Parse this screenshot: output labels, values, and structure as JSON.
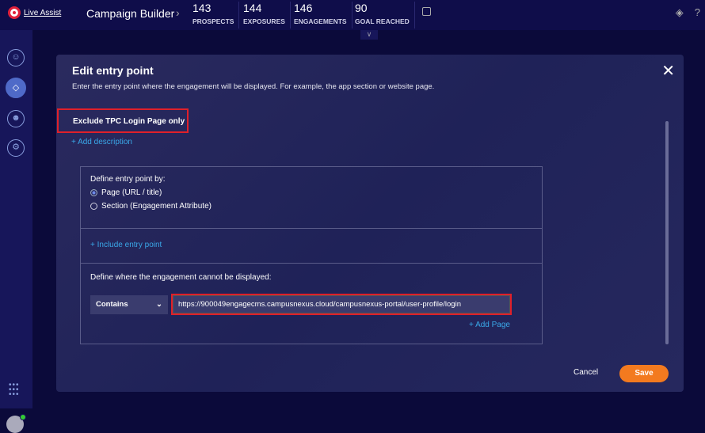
{
  "header": {
    "logo_text": "Live Assist",
    "title": "Campaign Builder",
    "stats": [
      {
        "value": "143",
        "label": "PROSPECTS"
      },
      {
        "value": "144",
        "label": "EXPOSURES"
      },
      {
        "value": "146",
        "label": "ENGAGEMENTS"
      },
      {
        "value": "90",
        "label": "GOAL REACHED"
      }
    ]
  },
  "sidebar": {
    "items": [
      {
        "icon": "bot-user-icon"
      },
      {
        "icon": "tag-icon",
        "active": true
      },
      {
        "icon": "user-icon"
      },
      {
        "icon": "robot-icon"
      }
    ]
  },
  "modal": {
    "title": "Edit entry point",
    "description": "Enter the entry point where the engagement will be displayed. For example, the app section or website page.",
    "name": "Exclude TPC Login Page only",
    "add_description": "+ Add description",
    "define_by_label": "Define entry point by:",
    "options": [
      "Page (URL / title)",
      "Section (Engagement Attribute)"
    ],
    "selected_option": "Page (URL / title)",
    "include_entry_point": "+ Include entry point",
    "exclude_label": "Define where the engagement cannot be displayed:",
    "match_type": "Contains",
    "url_value": "https://900049engagecms.campusnexus.cloud/campusnexus-portal/user-profile/login",
    "add_page": "+ Add Page",
    "cancel": "Cancel",
    "save": "Save"
  },
  "colors": {
    "accent": "#3aa8e8",
    "save": "#f37a1f",
    "highlight": "#e0202a"
  }
}
